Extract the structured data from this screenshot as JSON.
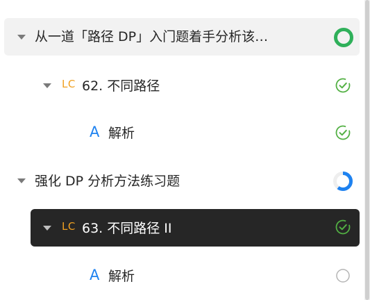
{
  "tree": {
    "items": [
      {
        "label": "从一道「路径 DP」入门题着手分析该…",
        "status": "complete-large",
        "badge": ""
      },
      {
        "label": "62. 不同路径",
        "status": "done",
        "badge": "LC"
      },
      {
        "label": "解析",
        "status": "done",
        "badge": "A"
      },
      {
        "label": "强化 DP 分析方法练习题",
        "status": "progress",
        "progress": 0.6,
        "badge": ""
      },
      {
        "label": "63. 不同路径 II",
        "status": "done",
        "badge": "LC"
      },
      {
        "label": "解析",
        "status": "empty",
        "badge": "A"
      }
    ]
  },
  "colors": {
    "green": "#2fb05a",
    "check_green": "#52b043",
    "blue": "#1e82f0",
    "orange": "#f0a020",
    "active_bg": "#262626",
    "hover_bg": "#f2f2f2"
  }
}
